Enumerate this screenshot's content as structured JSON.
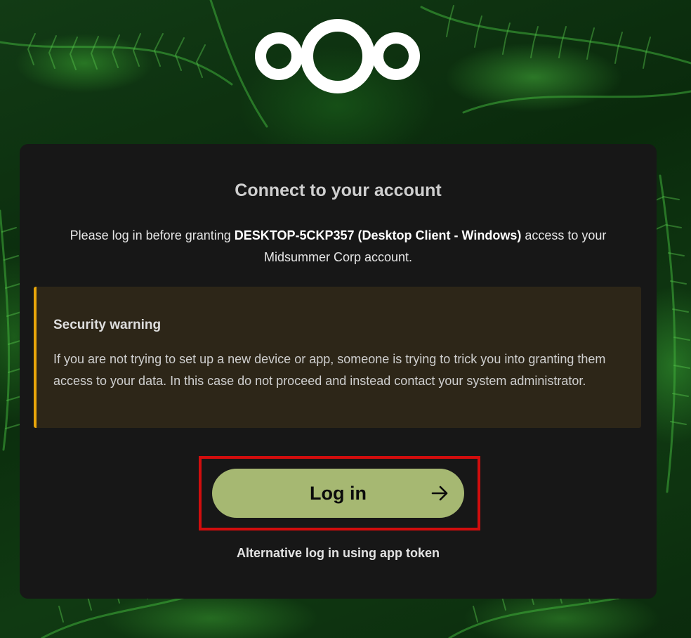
{
  "logo": {
    "icon": "nextcloud-logo-icon"
  },
  "card": {
    "title": "Connect to your account",
    "intro": {
      "prefix": "Please log in before granting ",
      "client": "DESKTOP-5CKP357 (Desktop Client - Windows)",
      "suffix": " access to your Midsummer Corp account."
    },
    "warning": {
      "title": "Security warning",
      "text": "If you are not trying to set up a new device or app, someone is trying to trick you into granting them access to your data. In this case do not proceed and instead contact your system administrator.",
      "accent_color": "#e9a60a"
    },
    "login_button": {
      "label": "Log in",
      "icon": "arrow-right-icon",
      "color": "#a6b872"
    },
    "highlight_color": "#d10d0d",
    "alt_login": "Alternative log in using app token"
  }
}
